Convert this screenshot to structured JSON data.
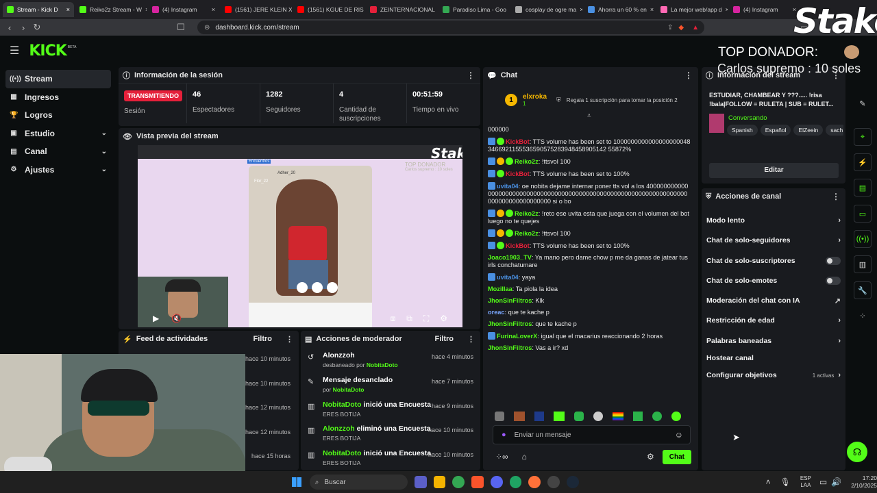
{
  "browser": {
    "tabs": [
      {
        "label": "Stream - Kick D",
        "color": "#53fc18",
        "active": true
      },
      {
        "label": "Reiko2z Stream - W",
        "color": "#53fc18"
      },
      {
        "label": "(4) Instagram",
        "color": "#d6249f"
      },
      {
        "label": "(1561) JERE KLEIN X",
        "color": "#ff0000"
      },
      {
        "label": "(1561) KGUE DE RIS",
        "color": "#ff0000"
      },
      {
        "label": "ZEINTERNACIONAL",
        "color": "#e5203a"
      },
      {
        "label": "Paradiso Lima - Goo",
        "color": "#34a853"
      },
      {
        "label": "cosplay de ogre ma",
        "color": "#aaaaaa"
      },
      {
        "label": "Ahorra un 60 % en",
        "color": "#4a90e2"
      },
      {
        "label": "La mejor web/app d",
        "color": "#ff69b4"
      },
      {
        "label": "(4) Instagram",
        "color": "#d6249f"
      }
    ],
    "new_tab": "+",
    "url": "dashboard.kick.com/stream"
  },
  "overlay": {
    "brand": "Stake",
    "top_donor_title": "TOP DONADOR:",
    "top_donor": "Carlos supremo : 10 soles"
  },
  "kick": {
    "logo": "KICK",
    "beta": "BETA"
  },
  "sidebar": {
    "items": [
      {
        "label": "Stream",
        "icon": "stream-icon",
        "glyph": "((•))"
      },
      {
        "label": "Ingresos",
        "icon": "revenue-icon",
        "glyph": "▦"
      },
      {
        "label": "Logros",
        "icon": "trophy-icon",
        "glyph": "🏆"
      },
      {
        "label": "Estudio",
        "icon": "studio-icon",
        "glyph": "▣",
        "chevron": "⌄"
      },
      {
        "label": "Canal",
        "icon": "channel-icon",
        "glyph": "▤",
        "chevron": "⌄"
      },
      {
        "label": "Ajustes",
        "icon": "gear-icon",
        "glyph": "⚙",
        "chevron": "⌄"
      }
    ]
  },
  "session": {
    "title": "Información de la sesión",
    "live_badge": "TRANSMITIENDO",
    "session_label": "Sesión",
    "stats": [
      {
        "value": "46",
        "label": "Espectadores"
      },
      {
        "value": "1282",
        "label": "Seguidores"
      },
      {
        "value": "4",
        "label": "Cantidad de suscripciones"
      },
      {
        "value": "00:51:59",
        "label": "Tiempo en vivo"
      }
    ]
  },
  "preview": {
    "title": "Vista previa del stream",
    "inner_donor_title": "TOP DONADOR",
    "inner_donor": "Carlos supremo : 10 soles",
    "inner_tag": "Encuentros",
    "inner_user": "Adher_20",
    "inner_user2": "Flor_22"
  },
  "feed": {
    "title": "Feed de actividades",
    "filter": "Filtro",
    "items": [
      "hace 10 minutos",
      "hace 10 minutos",
      "hace 12 minutos",
      "hace 12 minutos",
      "hace 15 horas"
    ]
  },
  "modactions": {
    "title": "Acciones de moderador",
    "filter": "Filtro",
    "items": [
      {
        "title": "Alonzzoh",
        "sub_pre": "desbaneado por",
        "sub_user": "NobitaDoto",
        "time": "hace 4 minutos",
        "icon": "undo-icon",
        "glyph": "↺"
      },
      {
        "title": "Mensaje desanclado",
        "sub_pre": "por",
        "sub_user": "NobitaDoto",
        "time": "hace 7 minutos",
        "icon": "unpin-icon",
        "glyph": "✎"
      },
      {
        "title_user": "NobitaDoto",
        "title": "inició una Encuesta",
        "sub_pre": "ERES BOTIJA",
        "sub_user": "",
        "time": "hace 9 minutos",
        "icon": "poll-icon",
        "glyph": "▥"
      },
      {
        "title_user": "Alonzzoh",
        "title": "eliminó una Encuesta",
        "sub_pre": "ERES BOTIJA",
        "sub_user": "",
        "time": "hace 10 minutos",
        "icon": "poll-icon",
        "glyph": "▥"
      },
      {
        "title_user": "NobitaDoto",
        "title": "inició una Encuesta",
        "sub_pre": "ERES BOTIJA",
        "sub_user": "",
        "time": "hace 10 minutos",
        "icon": "poll-icon",
        "glyph": "▥"
      }
    ]
  },
  "chat": {
    "title": "Chat",
    "pinned_user": "elxroka",
    "pinned_rank": "1",
    "pinned_count": "1",
    "pinned_text": "Regala 1 suscripción para tomar la posición 2",
    "messages": [
      {
        "user": "",
        "text": "000000",
        "color": "#e9e9e9"
      },
      {
        "user": "KickBot",
        "text": ": TTS volume has been set to 10000000000000000000483466921155536590575283948458905142 55872%",
        "color": "#e5203a",
        "badges": [
          "#4a90e2",
          "#53fc18"
        ]
      },
      {
        "user": "Reiko2z",
        "text": ": !ttsvol 100",
        "color": "#53fc18",
        "badges": [
          "#4a90e2",
          "#f5b700",
          "#53fc18"
        ]
      },
      {
        "user": "KickBot",
        "text": ": TTS volume has been set to 100%",
        "color": "#e5203a",
        "badges": [
          "#4a90e2",
          "#53fc18"
        ]
      },
      {
        "user": "uvita04",
        "text": ": oe nobita dejame internar poner tts vol a los 400000000000000000000000000000000000000000000000000000000000000000000000000000000000000 si o bo",
        "color": "#4a90e2",
        "badges": [
          "#4a90e2"
        ]
      },
      {
        "user": "Reiko2z",
        "text": ": !reto ese uvita esta que juega con el volumen del bot luego no te quejes",
        "color": "#53fc18",
        "badges": [
          "#4a90e2",
          "#f5b700",
          "#53fc18"
        ]
      },
      {
        "user": "Reiko2z",
        "text": ": !ttsvol 100",
        "color": "#53fc18",
        "badges": [
          "#4a90e2",
          "#f5b700",
          "#53fc18"
        ]
      },
      {
        "user": "KickBot",
        "text": ": TTS volume has been set to 100%",
        "color": "#e5203a",
        "badges": [
          "#4a90e2",
          "#53fc18"
        ]
      },
      {
        "user": "Joaco1903_TV",
        "text": ": Ya mano pero dame chow p me da ganas de jatear tus irls conchatumare",
        "color": "#53fc18"
      },
      {
        "user": "uvita04",
        "text": ": yaya",
        "color": "#4a90e2",
        "badges": [
          "#4a90e2"
        ]
      },
      {
        "user": "Mozillaa",
        "text": ": Ta piola la idea",
        "color": "#53fc18"
      },
      {
        "user": "JhonSinFiltros",
        "text": ": Klk",
        "color": "#53fc18"
      },
      {
        "user": "oreac",
        "text": ": que te kache p",
        "color": "#7aa7ff"
      },
      {
        "user": "JhonSinFiltros",
        "text": ": que te kache p",
        "color": "#53fc18"
      },
      {
        "user": "FurinaLoverX",
        "text": ": igual que el macarius reaccionando 2 horas",
        "color": "#53fc18",
        "badges": [
          "#4a90e2"
        ]
      },
      {
        "user": "JhonSinFiltros",
        "text": ": Vas a ir? xd",
        "color": "#53fc18"
      }
    ],
    "input_placeholder": "Enviar un mensaje",
    "send": "Chat"
  },
  "streaminfo": {
    "title": "Información del stream",
    "stream_title": "ESTUDIAR, CHAMBEAR Y ???..... !risa !bala|FOLLOW = RULETA | SUB = RULET...",
    "category": "Conversando",
    "tags": [
      "Spanish",
      "Español",
      "ElZeein",
      "sach"
    ],
    "edit": "Editar"
  },
  "channelactions": {
    "title": "Acciones de canal",
    "items": [
      {
        "label": "Modo lento",
        "kind": "chevron"
      },
      {
        "label": "Chat de solo-seguidores",
        "kind": "chevron"
      },
      {
        "label": "Chat de solo-suscriptores",
        "kind": "toggle"
      },
      {
        "label": "Chat de solo-emotes",
        "kind": "toggle"
      },
      {
        "label": "Moderación del chat con IA",
        "kind": "external"
      },
      {
        "label": "Restricción de edad",
        "kind": "chevron"
      },
      {
        "label": "Palabras baneadas",
        "kind": "chevron"
      },
      {
        "label": "Hostear canal",
        "kind": "none"
      },
      {
        "label": "Configurar objetivos",
        "kind": "chevron",
        "extra": "1 activas"
      }
    ]
  },
  "taskbar": {
    "search": "Buscar",
    "lang1": "ESP",
    "lang2": "LAA",
    "time": "17:20",
    "date": "2/10/2025"
  },
  "colors": {
    "accent": "#53fc18",
    "live": "#e5203a",
    "panel": "#191b1f",
    "bg": "#0b0e0f"
  }
}
